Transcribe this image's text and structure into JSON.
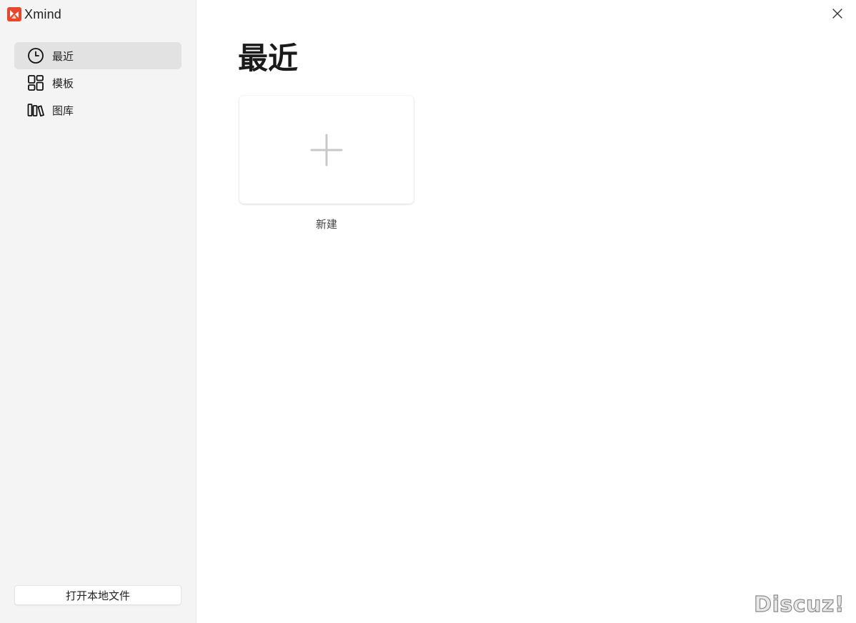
{
  "app": {
    "title": "Xmind",
    "accent": "#e8472c"
  },
  "sidebar": {
    "items": [
      {
        "label": "最近",
        "icon": "clock-icon",
        "active": true
      },
      {
        "label": "模板",
        "icon": "grid-icon",
        "active": false
      },
      {
        "label": "图库",
        "icon": "library-icon",
        "active": false
      }
    ],
    "open_local_label": "打开本地文件"
  },
  "main": {
    "title": "最近",
    "new_card": {
      "label": "新建",
      "icon": "plus-icon"
    }
  },
  "window": {
    "close_icon": "close-icon"
  },
  "watermark": "Discuz!"
}
